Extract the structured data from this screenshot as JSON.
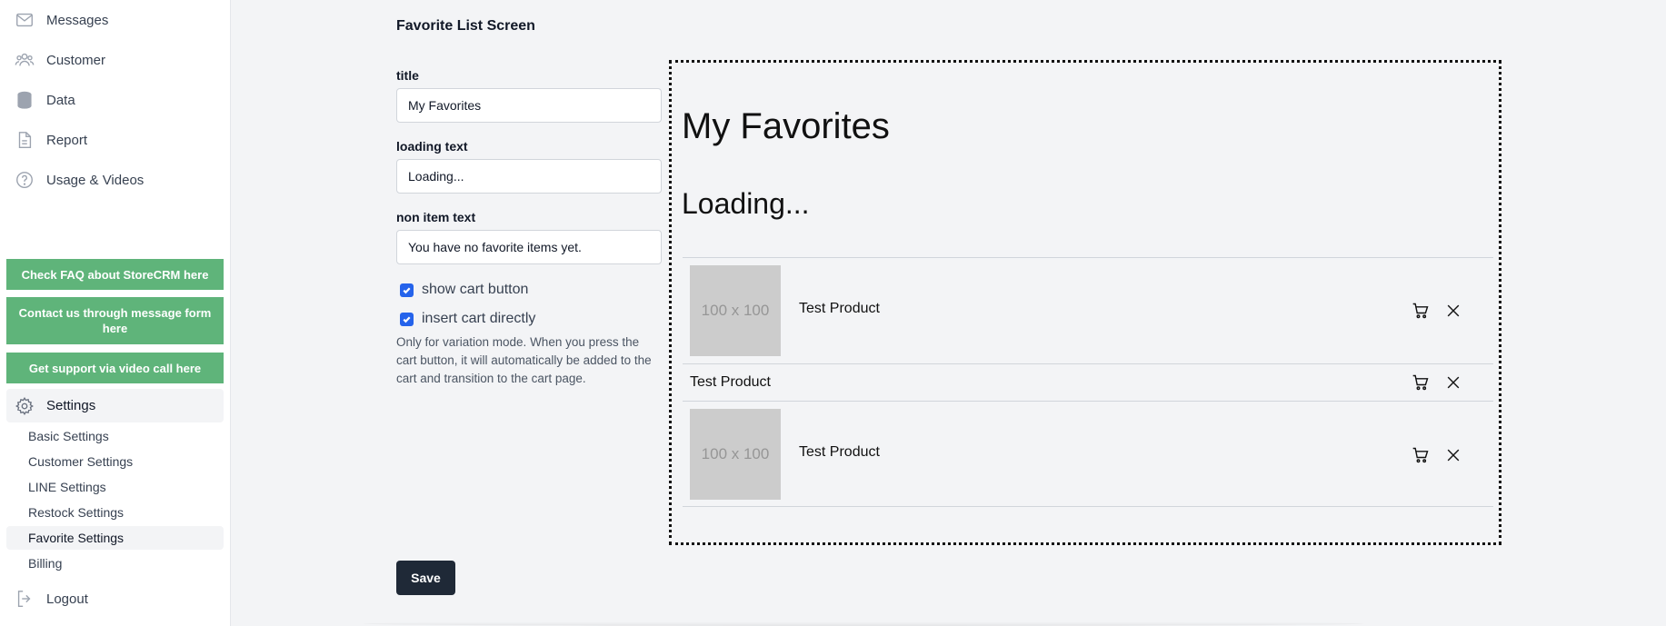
{
  "sidebar": {
    "nav": [
      {
        "label": "Messages",
        "icon": "mail-icon"
      },
      {
        "label": "Customer",
        "icon": "users-icon"
      },
      {
        "label": "Data",
        "icon": "database-icon"
      },
      {
        "label": "Report",
        "icon": "document-icon"
      },
      {
        "label": "Usage & Videos",
        "icon": "help-circle-icon"
      }
    ],
    "help_buttons": [
      "Check FAQ about StoreCRM here",
      "Contact us through message form here",
      "Get support via video call here"
    ],
    "settings_label": "Settings",
    "settings_items": [
      "Basic Settings",
      "Customer Settings",
      "LINE Settings",
      "Restock Settings",
      "Favorite Settings",
      "Billing"
    ],
    "active_settings_item": "Favorite Settings",
    "logout_label": "Logout"
  },
  "form": {
    "screen_title": "Favorite List Screen",
    "title_label": "title",
    "title_value": "My Favorites",
    "loading_label": "loading text",
    "loading_value": "Loading...",
    "non_item_label": "non item text",
    "non_item_value": "You have no favorite items yet.",
    "show_cart_label": "show cart button",
    "show_cart_checked": true,
    "insert_cart_label": "insert cart directly",
    "insert_cart_checked": true,
    "help_text": "Only for variation mode. When you press the cart button, it will automatically be added to the cart and transition to the cart page.",
    "save_label": "Save"
  },
  "preview": {
    "title": "My Favorites",
    "loading": "Loading...",
    "thumb_text": "100 x 100",
    "items": [
      {
        "name": "Test Product",
        "has_image": true
      },
      {
        "name": "Test Product",
        "has_image": false
      },
      {
        "name": "Test Product",
        "has_image": true
      }
    ]
  },
  "colors": {
    "accent_green": "#5fb47a",
    "checkbox_blue": "#2563eb",
    "save_dark": "#1f2937"
  }
}
